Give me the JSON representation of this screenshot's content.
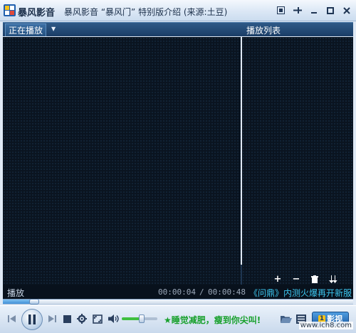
{
  "titlebar": {
    "app_name": "暴风影音",
    "window_title": "暴风影音 “暴风门” 特别版介绍 (来源:土豆)",
    "buttons": [
      "restore-icon",
      "pin-icon",
      "minimize-icon",
      "maximize-icon",
      "close-icon"
    ]
  },
  "header": {
    "now_playing_tab": "正在播放",
    "playlist_title": "播放列表"
  },
  "playlist_tools": [
    "+",
    "−",
    "🗑",
    "⇊"
  ],
  "status": {
    "state": "播放",
    "time_current": "00:00:04",
    "time_separator": "/",
    "time_total": "00:00:48",
    "ticker": "《问鼎》内测火爆再开新服"
  },
  "progress": {
    "fraction": 0.09
  },
  "volume": {
    "fraction": 0.55
  },
  "controls": {
    "promo_text": "★睡觉减肥，瘦到你尖叫!",
    "brand_label": "影视",
    "brand_badge": "1"
  },
  "watermark": "www.ich8.com",
  "colors": {
    "accent_blue": "#1b3d66",
    "video_bg": "#0a1420",
    "ticker": "#3cc6ef",
    "promo_green": "#17a02b"
  }
}
